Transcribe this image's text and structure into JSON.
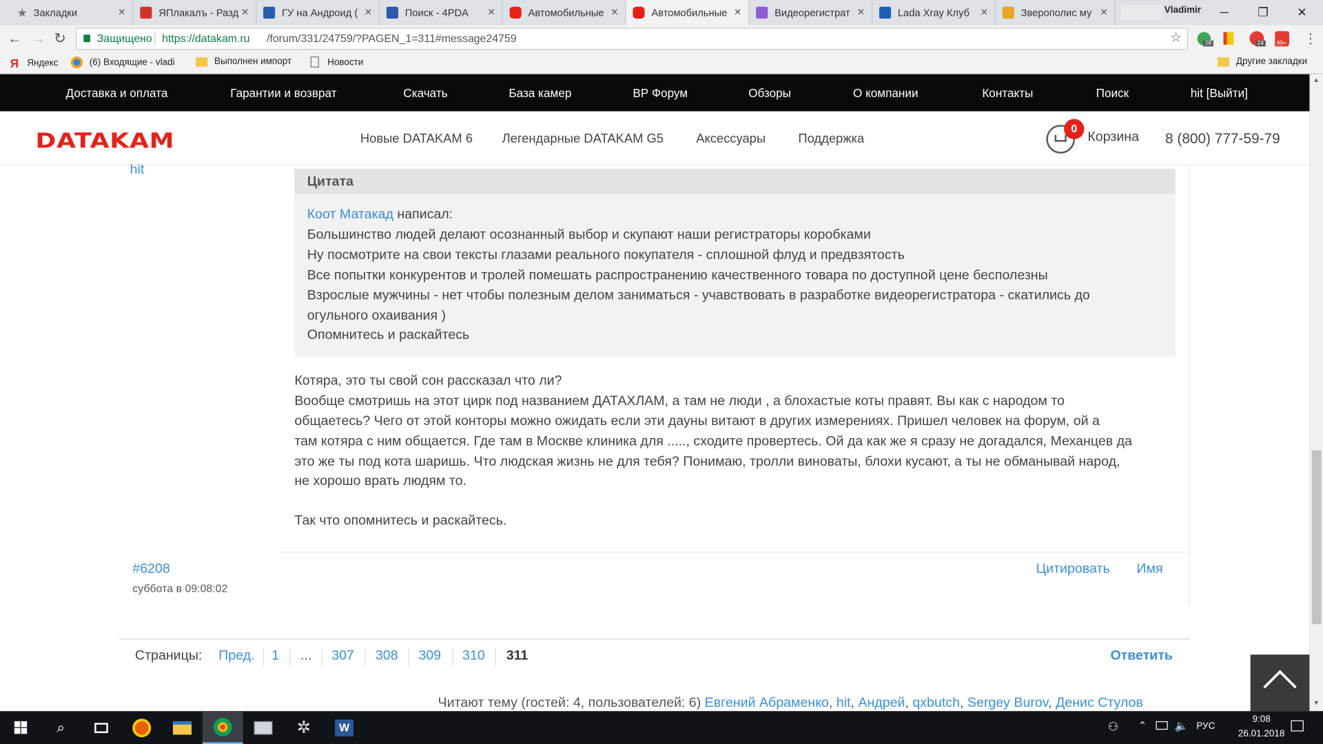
{
  "browser": {
    "tabs": [
      {
        "title": "Закладки",
        "favicon_color": "#888888"
      },
      {
        "title": "ЯПлакалъ - Разд",
        "favicon_color": "#d0342c"
      },
      {
        "title": "ГУ на Андроид (",
        "favicon_color": "#2a5aa8"
      },
      {
        "title": "Поиск - 4PDA",
        "favicon_color": "#2a5aa8"
      },
      {
        "title": "Автомобильные",
        "favicon_color": "#e62117"
      },
      {
        "title": "Автомобильные",
        "favicon_color": "#e62117"
      },
      {
        "title": "Видеорегистрат",
        "favicon_color": "#8b5fd6"
      },
      {
        "title": "Lada Xray Клуб",
        "favicon_color": "#1d5fb5"
      },
      {
        "title": "Зверополис му",
        "favicon_color": "#e9a524"
      }
    ],
    "active_tab_index": 5,
    "profile_name": "Vladimir",
    "secure_label": "Защищено",
    "url_base": "https://datakam.ru",
    "url_path": "/forum/331/24759/?PAGEN_1=311#message24759",
    "extension_badges": [
      "28",
      "24",
      "99+"
    ],
    "bookmarks": [
      {
        "label": "Яндекс",
        "icon": "yandex-icon"
      },
      {
        "label": "(6) Входящие - vladi",
        "icon": "mail-icon"
      },
      {
        "label": "Выполнен импорт",
        "icon": "folder-icon"
      },
      {
        "label": "Новости",
        "icon": "page-icon"
      }
    ],
    "other_bookmarks": "Другие закладки"
  },
  "site": {
    "top_menu": [
      "Доставка и оплата",
      "Гарантии и возврат",
      "Скачать",
      "База камер",
      "ВР Форум",
      "Обзоры",
      "О компании",
      "Контакты",
      "Поиск",
      "hit [Выйти]"
    ],
    "logo": "DATAKAM",
    "main_menu": [
      "Новые DATAKAM 6",
      "Легендарные DATAKAM G5",
      "Аксессуары",
      "Поддержка"
    ],
    "cart_count": "0",
    "cart_label": "Корзина",
    "phone": "8 (800) 777-59-79"
  },
  "post": {
    "author": "hit",
    "quote_title": "Цитата",
    "quote_author": "Коот Матакад",
    "quote_wrote": " написал:",
    "quote_lines": [
      "Большинство людей делают осознанный выбор и скупают наши регистраторы коробками",
      "Ну посмотрите на свои тексты глазами реального покупателя - сплошной флуд и предвзятость",
      "Все попытки конкурентов и тролей помешать распространению качественного товара по доступной цене бесполезны",
      "Взрослые мужчины - нет чтобы полезным делом заниматься - учавствовать в разработке видеорегистратора - скатились до",
      "огульного охаивания )",
      "Опомнитесь и раскайтесь"
    ],
    "body_lines": [
      "Котяра, это ты свой сон рассказал что ли?",
      "Вообще смотришь на этот цирк под названием ДАТАХЛАМ, а там не люди , а блохастые коты правят. Вы как с народом то",
      "общаетесь? Чего от этой конторы можно ожидать если эти дауны витают в других измерениях. Пришел человек на форум, ой а",
      "там котяра с ним общается. Где там в Москве клиника для ....., сходите провертесь. Ой да как же я сразу не догадался, Механцев да",
      "это же ты под кота шаришь. Что людская жизнь не для тебя? Понимаю, тролли виноваты, блохи кусают, а ты не обманывай народ,",
      "не хорошо врать людям то."
    ],
    "closing": "Так что опомнитесь и раскайтесь.",
    "number": "#6208",
    "date": "суббота в 09:08:02",
    "actions": [
      "Цитировать",
      "Имя"
    ]
  },
  "pagination": {
    "label": "Страницы:",
    "prev": "Пред.",
    "pages": [
      "1",
      "...",
      "307",
      "308",
      "309",
      "310",
      "311"
    ],
    "current": "311",
    "reply": "Ответить"
  },
  "readers": {
    "prefix": "Читают тему (гостей: 4, пользователей: 6)",
    "users": [
      "Евгений Абраменко",
      "hit",
      "Андрей",
      "qxbutch",
      "Sergey Burov",
      "Денис Стулов"
    ]
  },
  "taskbar": {
    "lang": "РУС",
    "time": "9:08",
    "date": "26.01.2018"
  }
}
